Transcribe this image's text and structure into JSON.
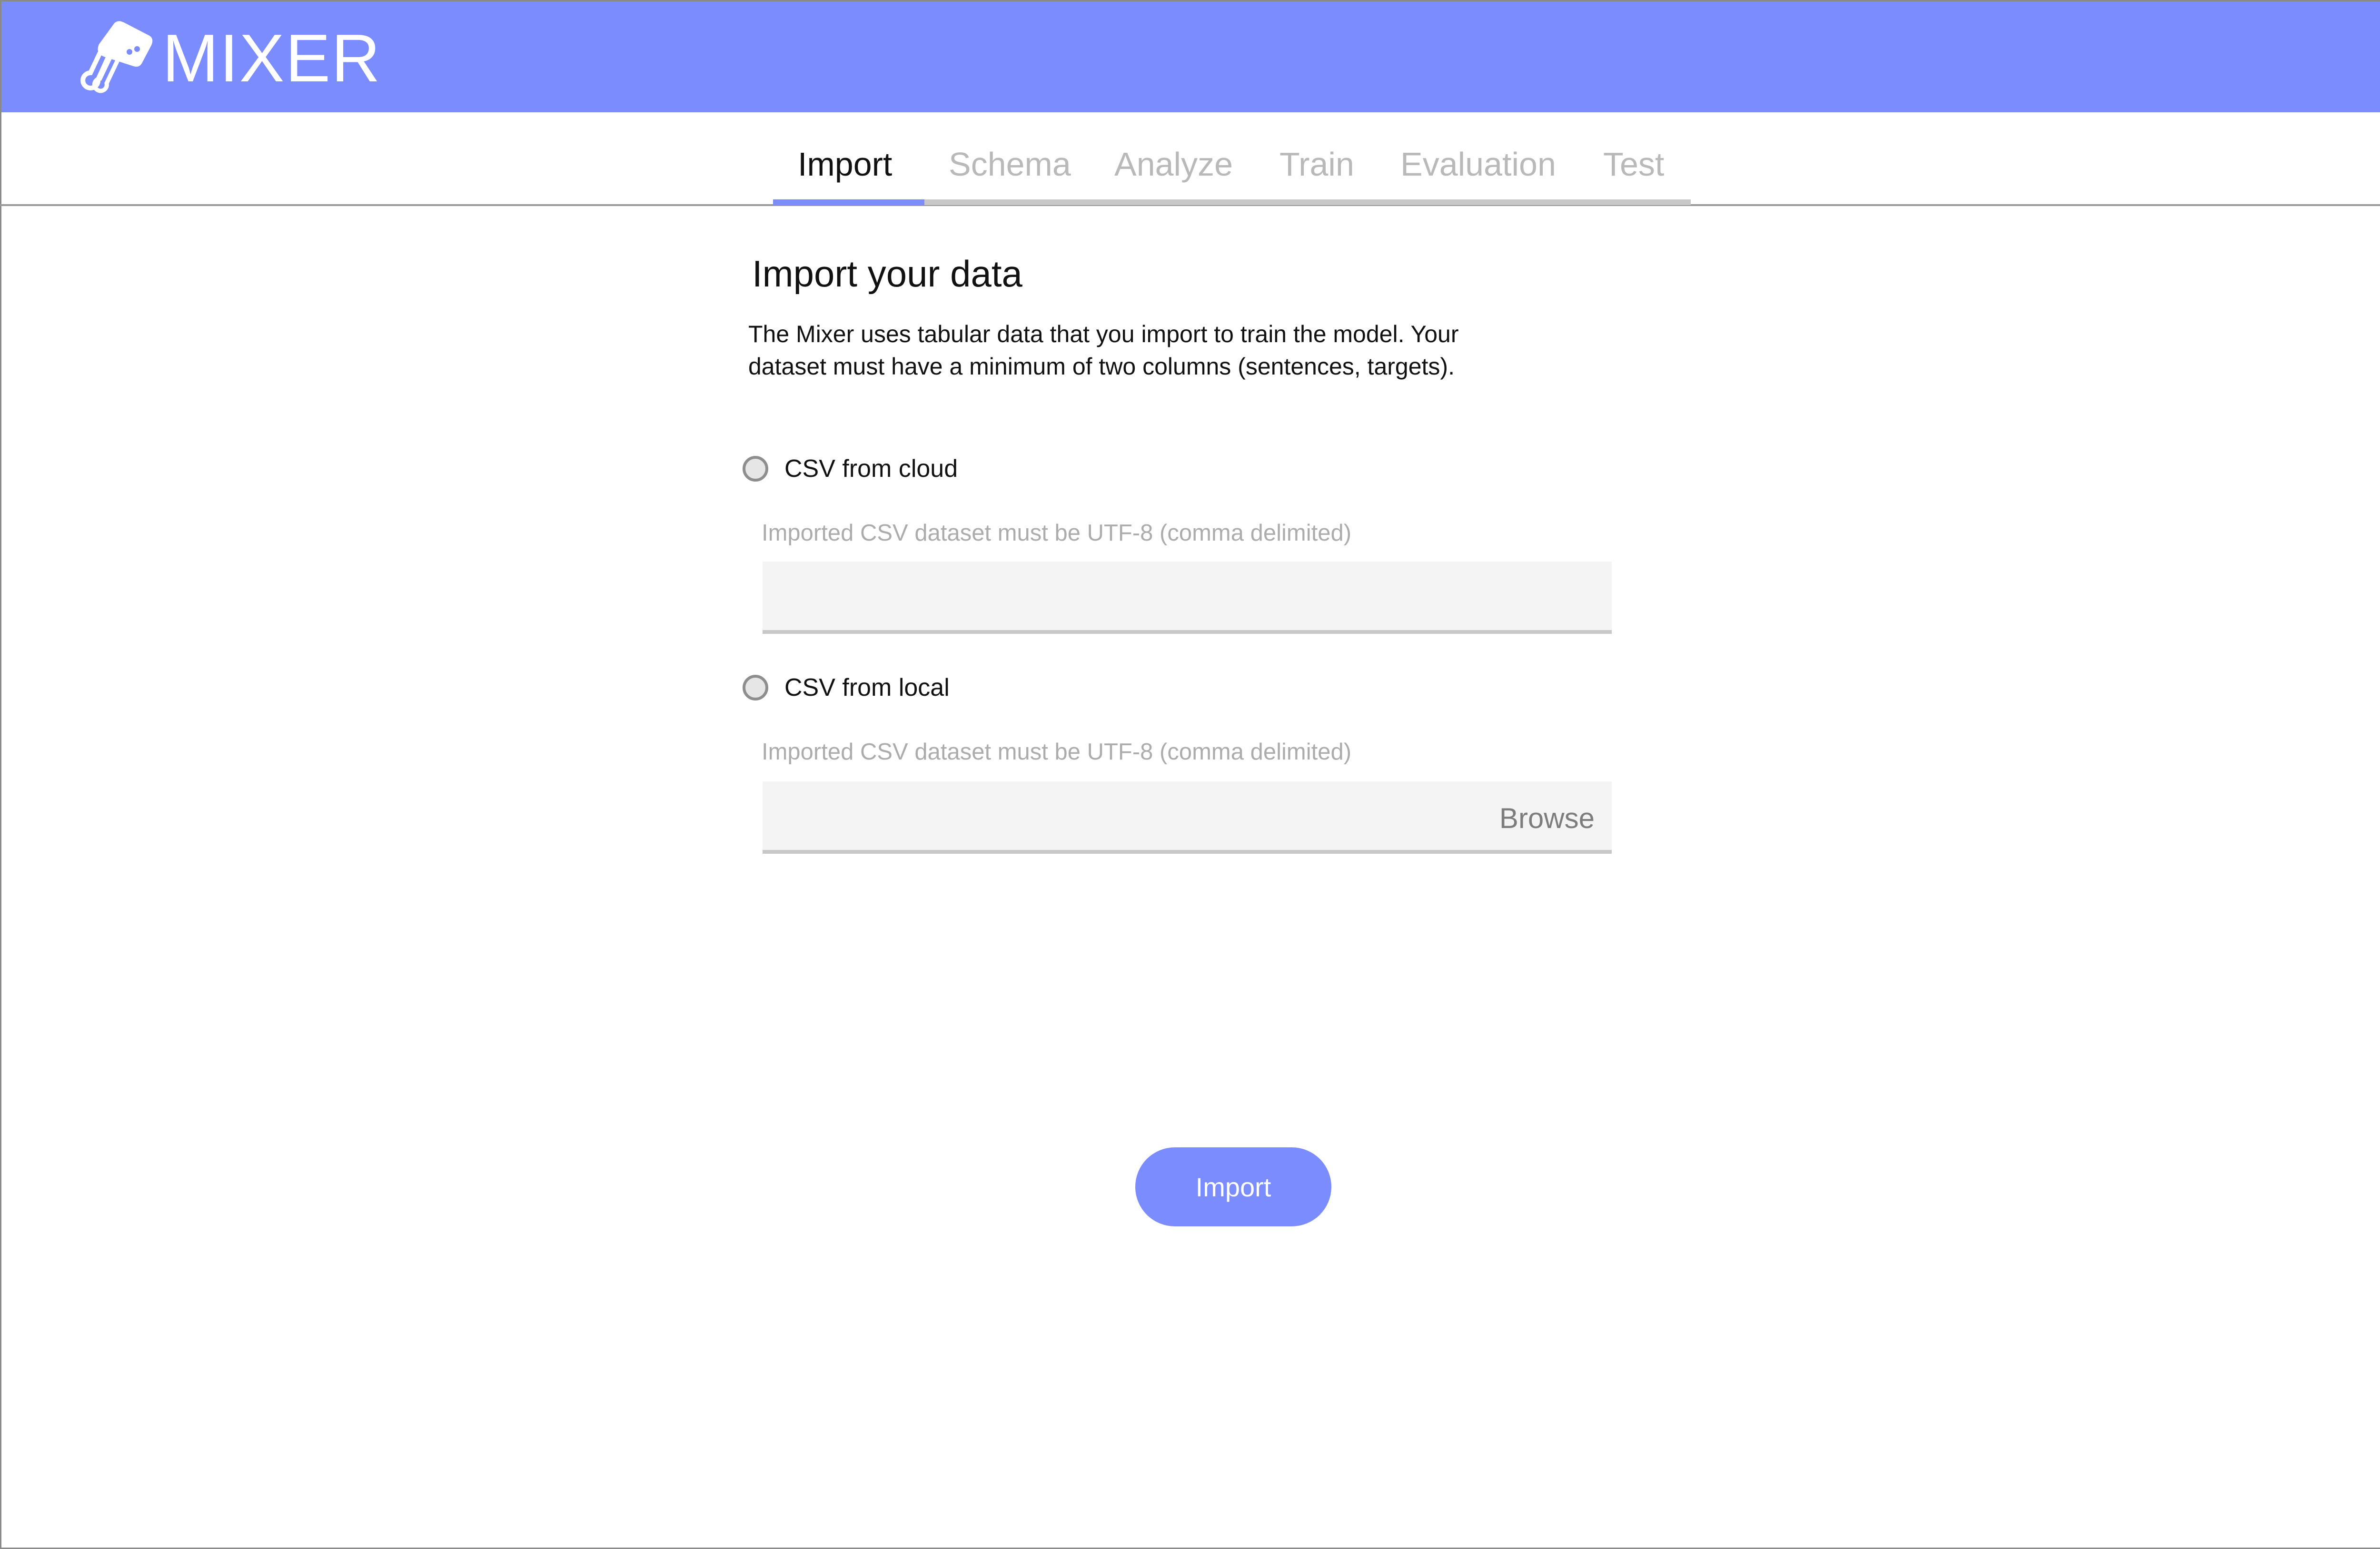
{
  "app": {
    "brand": "MIXER",
    "logo_icon": "hand-mixer-icon"
  },
  "colors": {
    "accent": "#7b8cff",
    "header_text": "#ffffff",
    "tab_inactive": "#b9b9b9",
    "field_bg": "#f4f4f4"
  },
  "tabs": [
    {
      "label": "Import",
      "active": true
    },
    {
      "label": "Schema",
      "active": false
    },
    {
      "label": "Analyze",
      "active": false
    },
    {
      "label": "Train",
      "active": false
    },
    {
      "label": "Evaluation",
      "active": false
    },
    {
      "label": "Test",
      "active": false
    }
  ],
  "main": {
    "title": "Import your data",
    "description_line1": "The Mixer uses tabular data that you import to train the model. Your",
    "description_line2": "dataset must have a minimum of two columns (sentences, targets).",
    "options": {
      "cloud": {
        "label": "CSV from cloud",
        "hint": "Imported CSV dataset must be UTF-8 (comma delimited)",
        "value": "",
        "selected": false
      },
      "local": {
        "label": "CSV from local",
        "hint": "Imported CSV dataset must be UTF-8 (comma delimited)",
        "value": "",
        "selected": false,
        "browse_label": "Browse"
      }
    },
    "import_button": "Import"
  }
}
